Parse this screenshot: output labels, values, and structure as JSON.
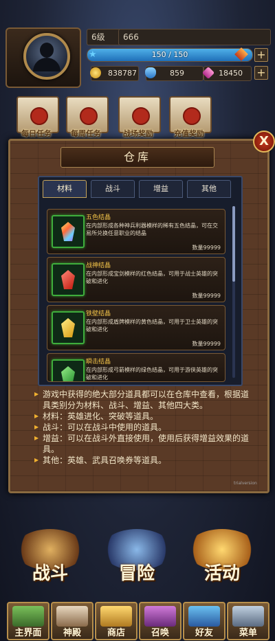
{
  "player": {
    "level": "6级",
    "name": "666",
    "exp_text": "150 / 150",
    "exp_fraction": 1.0,
    "gold": "838787",
    "crystal": "859",
    "diamond": "18450"
  },
  "quests": [
    {
      "label": "每日任务"
    },
    {
      "label": "每周任务"
    },
    {
      "label": "战场奖励"
    },
    {
      "label": "充值奖励"
    }
  ],
  "warehouse": {
    "title": "仓库",
    "close": "X",
    "tabs": [
      "材料",
      "战斗",
      "增益",
      "其他"
    ],
    "active_tab": 0,
    "items": [
      {
        "name": "五色结晶",
        "desc": "在内部形成各种神兵利器模样的稀有五色结晶，可在交易所兑换任意职业的结晶",
        "count": "数量99999",
        "color": "#9fe07a"
      },
      {
        "name": "战神结晶",
        "desc": "在内部形成宝剑模样的红色结晶，可用于战士英雄的突破和进化",
        "count": "数量99999",
        "color": "#e23a2a"
      },
      {
        "name": "铁壁结晶",
        "desc": "在内部形成盾牌模样的黄色结晶，可用于卫士英雄的突破和进化",
        "count": "数量99999",
        "color": "#f2c23a"
      },
      {
        "name": "瞬击结晶",
        "desc": "在内部形成弓箭模样的绿色结晶，可用于游侠英雄的突破和进化",
        "count": "",
        "color": "#3fbf4a"
      }
    ],
    "info": [
      "游戏中获得的绝大部分道具都可以在仓库中查看，根据道具类别分为材料、战斗、增益、其他四大类。",
      "材料：英雄进化、突破等道具。",
      "战斗：可以在战斗中使用的道具。",
      "增益：可以在战斗外直接使用，使用后获得增益效果的道具。",
      "其他：英雄、武具召唤券等道具。"
    ],
    "version_tag": "trialversion"
  },
  "main_buttons": [
    {
      "label": "战斗"
    },
    {
      "label": "冒险"
    },
    {
      "label": "活动"
    }
  ],
  "nav": [
    {
      "label": "主界面"
    },
    {
      "label": "神殿"
    },
    {
      "label": "商店"
    },
    {
      "label": "召唤"
    },
    {
      "label": "好友"
    },
    {
      "label": "菜单"
    }
  ],
  "colors": {
    "panel": "#5a3a26",
    "accent_gold": "#f3c449",
    "tab_active_border": "#c7a55a",
    "exp_fill": "#1f6fb8"
  }
}
